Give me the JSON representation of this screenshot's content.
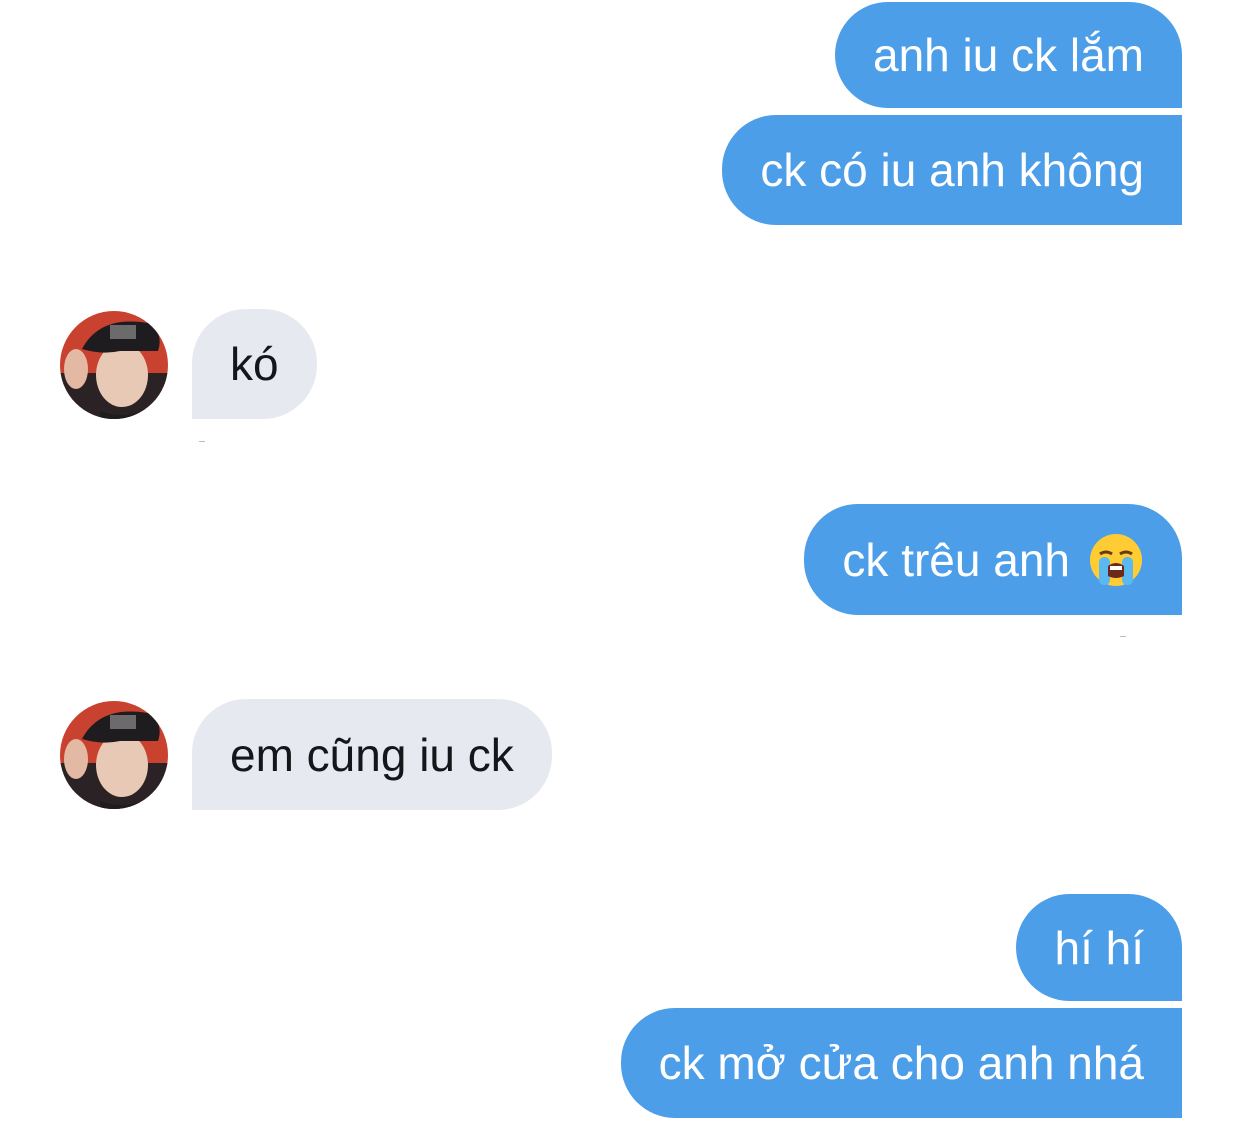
{
  "conversation": {
    "messages": [
      {
        "sender": "me",
        "text": "anh iu ck lắm"
      },
      {
        "sender": "me",
        "text": "ck có iu anh không"
      },
      {
        "sender": "them",
        "text": "kó"
      },
      {
        "sender": "me",
        "text": "ck trêu anh",
        "emoji": "loudly-crying-face"
      },
      {
        "sender": "them",
        "text": "em cũng iu ck"
      },
      {
        "sender": "me",
        "text": "hí hí"
      },
      {
        "sender": "me",
        "text": "ck mở cửa cho anh nhá"
      }
    ]
  },
  "colors": {
    "outgoing_bubble": "#4d9ee9",
    "incoming_bubble": "#e6e9f0",
    "background": "#ffffff"
  }
}
